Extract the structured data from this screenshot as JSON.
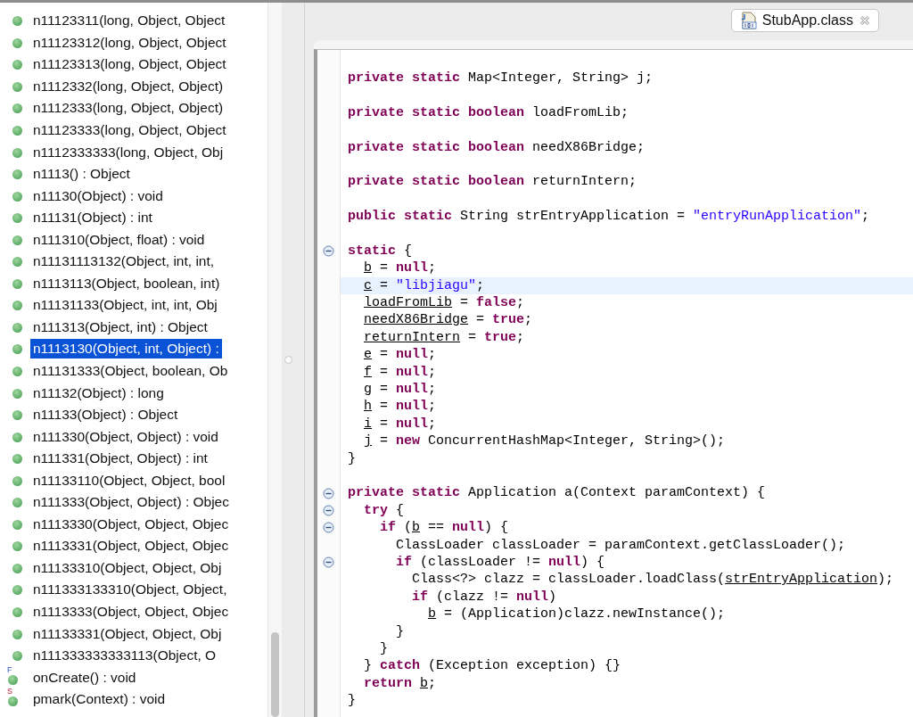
{
  "outline": {
    "items": [
      {
        "text": "n11123311(long, Object, Object",
        "selected": false
      },
      {
        "text": "n11123312(long, Object, Object",
        "selected": false
      },
      {
        "text": "n11123313(long, Object, Object",
        "selected": false
      },
      {
        "text": "n1112332(long, Object, Object)",
        "selected": false
      },
      {
        "text": "n1112333(long, Object, Object)",
        "selected": false
      },
      {
        "text": "n11123333(long, Object, Object",
        "selected": false
      },
      {
        "text": "n1112333333(long, Object, Obj",
        "selected": false
      },
      {
        "text": "n1113() : Object",
        "selected": false
      },
      {
        "text": "n11130(Object) : void",
        "selected": false
      },
      {
        "text": "n11131(Object) : int",
        "selected": false
      },
      {
        "text": "n111310(Object, float) : void",
        "selected": false
      },
      {
        "text": "n11131113132(Object, int, int,",
        "selected": false
      },
      {
        "text": "n1113113(Object, boolean, int)",
        "selected": false
      },
      {
        "text": "n11131133(Object, int, int, Obj",
        "selected": false
      },
      {
        "text": "n111313(Object, int) : Object",
        "selected": false
      },
      {
        "text": "n1113130(Object, int, Object) :",
        "selected": true
      },
      {
        "text": "n11131333(Object, boolean, Ob",
        "selected": false
      },
      {
        "text": "n11132(Object) : long",
        "selected": false
      },
      {
        "text": "n11133(Object) : Object",
        "selected": false
      },
      {
        "text": "n111330(Object, Object) : void",
        "selected": false
      },
      {
        "text": "n111331(Object, Object) : int",
        "selected": false
      },
      {
        "text": "n11133110(Object, Object, bool",
        "selected": false
      },
      {
        "text": "n111333(Object, Object) : Objec",
        "selected": false
      },
      {
        "text": "n1113330(Object, Object, Objec",
        "selected": false
      },
      {
        "text": "n1113331(Object, Object, Objec",
        "selected": false
      },
      {
        "text": "n11133310(Object, Object, Obj",
        "selected": false
      },
      {
        "text": "n111333133310(Object, Object,",
        "selected": false
      },
      {
        "text": "n1113333(Object, Object, Objec",
        "selected": false
      },
      {
        "text": "n11133331(Object, Object, Obj",
        "selected": false
      },
      {
        "text": "n111333333333113(Object, O",
        "selected": false
      },
      {
        "text": "onCreate() : void",
        "selected": false,
        "overlay": {
          "kind": "final",
          "text": "F"
        }
      },
      {
        "text": "pmark(Context) : void",
        "selected": false,
        "overlay": {
          "kind": "static",
          "text": "S"
        }
      }
    ]
  },
  "editor": {
    "tab": {
      "title": "StubApp.class",
      "selected": true
    },
    "code_lines": [
      {
        "kind": "code",
        "tokens": [
          {
            "kind": "kw",
            "text": "private static"
          },
          {
            "kind": "plain",
            "text": " Map<Integer, String> j;"
          }
        ]
      },
      {
        "kind": "blank"
      },
      {
        "kind": "code",
        "tokens": [
          {
            "kind": "kw",
            "text": "private static boolean"
          },
          {
            "kind": "plain",
            "text": " loadFromLib;"
          }
        ]
      },
      {
        "kind": "blank"
      },
      {
        "kind": "code",
        "tokens": [
          {
            "kind": "kw",
            "text": "private static boolean"
          },
          {
            "kind": "plain",
            "text": " needX86Bridge;"
          }
        ]
      },
      {
        "kind": "blank"
      },
      {
        "kind": "code",
        "tokens": [
          {
            "kind": "kw",
            "text": "private static boolean"
          },
          {
            "kind": "plain",
            "text": " returnIntern;"
          }
        ]
      },
      {
        "kind": "blank"
      },
      {
        "kind": "code",
        "tokens": [
          {
            "kind": "kw",
            "text": "public static"
          },
          {
            "kind": "plain",
            "text": " String strEntryApplication = "
          },
          {
            "kind": "str",
            "text": "\"entryRunApplication\""
          },
          {
            "kind": "plain",
            "text": ";"
          }
        ]
      },
      {
        "kind": "blank"
      },
      {
        "kind": "code",
        "expanded": true,
        "tokens": [
          {
            "kind": "kw",
            "text": "static"
          },
          {
            "kind": "plain",
            "text": " {"
          }
        ],
        "children": [
          {
            "kind": "code",
            "tokens": [
              {
                "kind": "ref",
                "text": "b"
              },
              {
                "kind": "plain",
                "text": " = "
              },
              {
                "kind": "kw",
                "text": "null"
              },
              {
                "kind": "plain",
                "text": ";"
              }
            ]
          },
          {
            "kind": "code",
            "highlighted": true,
            "tokens": [
              {
                "kind": "ref",
                "text": "c"
              },
              {
                "kind": "plain",
                "text": " = "
              },
              {
                "kind": "str",
                "text": "\"libjiagu\""
              },
              {
                "kind": "plain",
                "text": ";"
              }
            ]
          },
          {
            "kind": "code",
            "tokens": [
              {
                "kind": "ref",
                "text": "loadFromLib"
              },
              {
                "kind": "plain",
                "text": " = "
              },
              {
                "kind": "kw",
                "text": "false"
              },
              {
                "kind": "plain",
                "text": ";"
              }
            ]
          },
          {
            "kind": "code",
            "tokens": [
              {
                "kind": "ref",
                "text": "needX86Bridge"
              },
              {
                "kind": "plain",
                "text": " = "
              },
              {
                "kind": "kw",
                "text": "true"
              },
              {
                "kind": "plain",
                "text": ";"
              }
            ]
          },
          {
            "kind": "code",
            "tokens": [
              {
                "kind": "ref",
                "text": "returnIntern"
              },
              {
                "kind": "plain",
                "text": " = "
              },
              {
                "kind": "kw",
                "text": "true"
              },
              {
                "kind": "plain",
                "text": ";"
              }
            ]
          },
          {
            "kind": "code",
            "tokens": [
              {
                "kind": "ref",
                "text": "e"
              },
              {
                "kind": "plain",
                "text": " = "
              },
              {
                "kind": "kw",
                "text": "null"
              },
              {
                "kind": "plain",
                "text": ";"
              }
            ]
          },
          {
            "kind": "code",
            "tokens": [
              {
                "kind": "ref",
                "text": "f"
              },
              {
                "kind": "plain",
                "text": " = "
              },
              {
                "kind": "kw",
                "text": "null"
              },
              {
                "kind": "plain",
                "text": ";"
              }
            ]
          },
          {
            "kind": "code",
            "tokens": [
              {
                "kind": "ref",
                "text": "g"
              },
              {
                "kind": "plain",
                "text": " = "
              },
              {
                "kind": "kw",
                "text": "null"
              },
              {
                "kind": "plain",
                "text": ";"
              }
            ]
          },
          {
            "kind": "code",
            "tokens": [
              {
                "kind": "ref",
                "text": "h"
              },
              {
                "kind": "plain",
                "text": " = "
              },
              {
                "kind": "kw",
                "text": "null"
              },
              {
                "kind": "plain",
                "text": ";"
              }
            ]
          },
          {
            "kind": "code",
            "tokens": [
              {
                "kind": "ref",
                "text": "i"
              },
              {
                "kind": "plain",
                "text": " = "
              },
              {
                "kind": "kw",
                "text": "null"
              },
              {
                "kind": "plain",
                "text": ";"
              }
            ]
          },
          {
            "kind": "code",
            "tokens": [
              {
                "kind": "ref",
                "text": "j"
              },
              {
                "kind": "plain",
                "text": " = "
              },
              {
                "kind": "kw",
                "text": "new"
              },
              {
                "kind": "plain",
                "text": " ConcurrentHashMap<Integer, String>();"
              }
            ]
          }
        ]
      },
      {
        "kind": "code",
        "tokens": [
          {
            "kind": "plain",
            "text": "}"
          }
        ]
      },
      {
        "kind": "blank"
      },
      {
        "kind": "code",
        "expanded": true,
        "tokens": [
          {
            "kind": "kw",
            "text": "private static"
          },
          {
            "kind": "plain",
            "text": " Application a(Context paramContext) {"
          }
        ],
        "children": [
          {
            "kind": "code",
            "expanded": true,
            "tokens": [
              {
                "kind": "kw",
                "text": "try"
              },
              {
                "kind": "plain",
                "text": " {"
              }
            ],
            "children": [
              {
                "kind": "code",
                "expanded": true,
                "tokens": [
                  {
                    "kind": "kw",
                    "text": "if"
                  },
                  {
                    "kind": "plain",
                    "text": " ("
                  },
                  {
                    "kind": "ref",
                    "text": "b"
                  },
                  {
                    "kind": "plain",
                    "text": " == "
                  },
                  {
                    "kind": "kw",
                    "text": "null"
                  },
                  {
                    "kind": "plain",
                    "text": ") {"
                  }
                ],
                "children": [
                  {
                    "kind": "code",
                    "tokens": [
                      {
                        "kind": "plain",
                        "text": "ClassLoader classLoader = paramContext.getClassLoader();"
                      }
                    ]
                  },
                  {
                    "kind": "code",
                    "expanded": true,
                    "tokens": [
                      {
                        "kind": "kw",
                        "text": "if"
                      },
                      {
                        "kind": "plain",
                        "text": " (classLoader != "
                      },
                      {
                        "kind": "kw",
                        "text": "null"
                      },
                      {
                        "kind": "plain",
                        "text": ") {"
                      }
                    ],
                    "children": [
                      {
                        "kind": "code",
                        "tokens": [
                          {
                            "kind": "plain",
                            "text": "Class<?> clazz = classLoader.loadClass("
                          },
                          {
                            "kind": "ref",
                            "text": "strEntryApplication"
                          },
                          {
                            "kind": "plain",
                            "text": ");"
                          }
                        ]
                      },
                      {
                        "kind": "code",
                        "tokens": [
                          {
                            "kind": "kw",
                            "text": "if"
                          },
                          {
                            "kind": "plain",
                            "text": " (clazz != "
                          },
                          {
                            "kind": "kw",
                            "text": "null"
                          },
                          {
                            "kind": "plain",
                            "text": ")"
                          }
                        ],
                        "children": [
                          {
                            "kind": "code",
                            "tokens": [
                              {
                                "kind": "ref",
                                "text": "b"
                              },
                              {
                                "kind": "plain",
                                "text": " = (Application)clazz.newInstance();"
                              }
                            ]
                          }
                        ]
                      }
                    ]
                  },
                  {
                    "kind": "code",
                    "tokens": [
                      {
                        "kind": "plain",
                        "text": "}"
                      }
                    ]
                  }
                ]
              },
              {
                "kind": "code",
                "tokens": [
                  {
                    "kind": "plain",
                    "text": "}"
                  }
                ]
              }
            ]
          },
          {
            "kind": "code",
            "tokens": [
              {
                "kind": "plain",
                "text": "} "
              },
              {
                "kind": "kw",
                "text": "catch"
              },
              {
                "kind": "plain",
                "text": " (Exception exception) {}"
              }
            ]
          },
          {
            "kind": "code",
            "tokens": [
              {
                "kind": "kw",
                "text": "return "
              },
              {
                "kind": "ref",
                "text": "b"
              },
              {
                "kind": "plain",
                "text": ";"
              }
            ]
          }
        ]
      },
      {
        "kind": "code",
        "tokens": [
          {
            "kind": "plain",
            "text": "}"
          }
        ]
      }
    ]
  }
}
